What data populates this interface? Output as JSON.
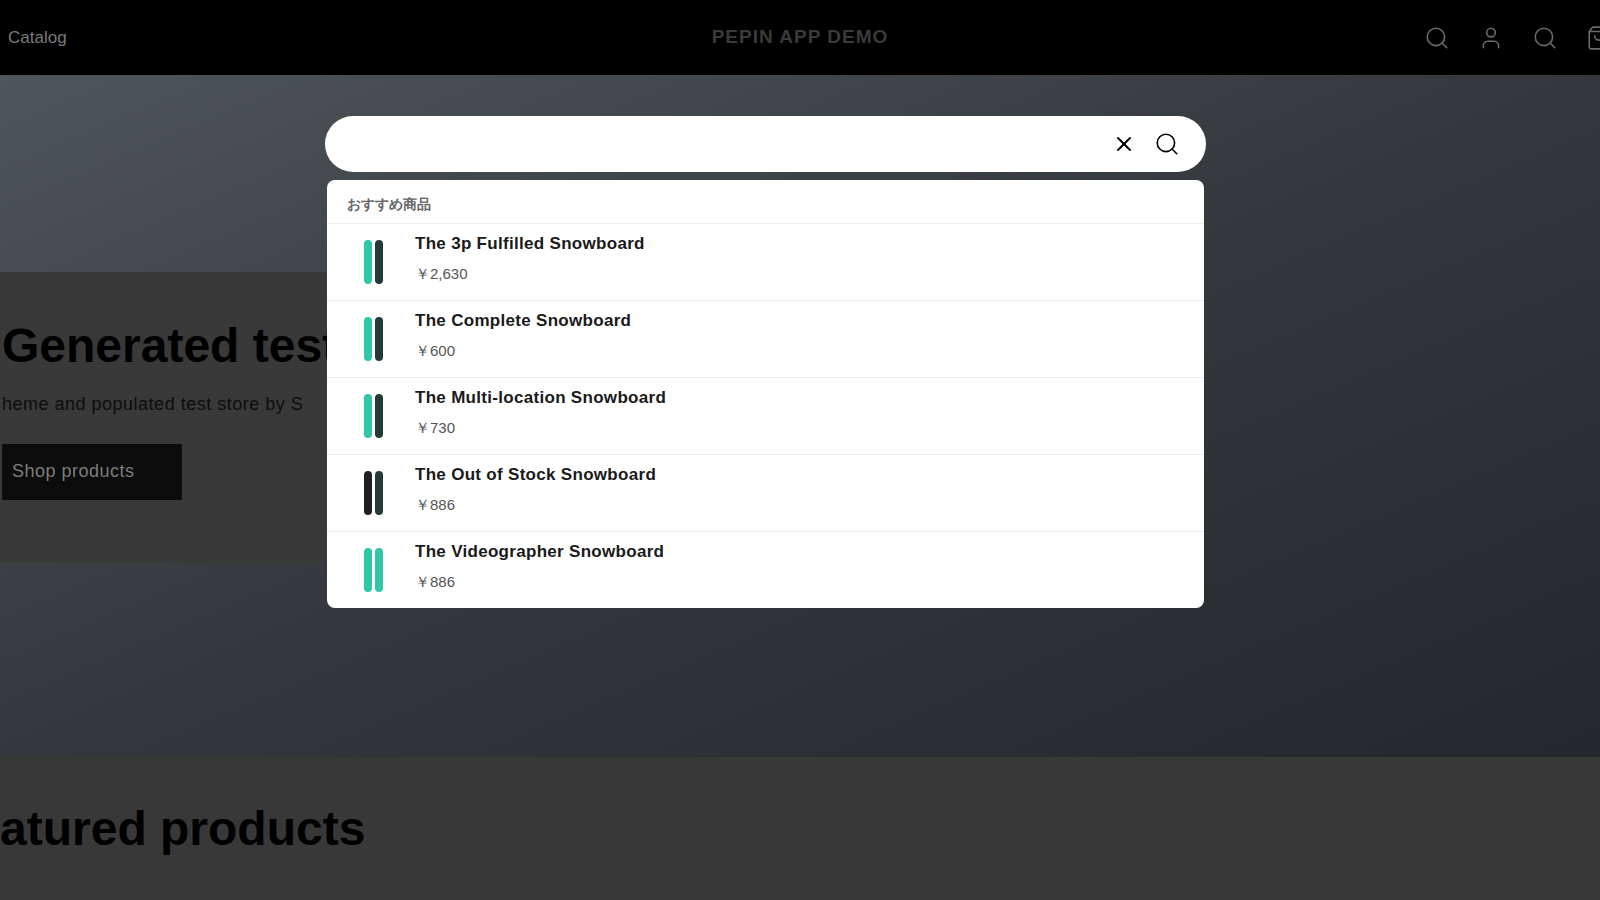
{
  "header": {
    "nav": [
      "Catalog"
    ],
    "title": "PEPIN APP DEMO"
  },
  "hero": {
    "heading": "Generated test",
    "text": "heme and populated test store by S",
    "button": "Shop products"
  },
  "featured": {
    "heading": "atured products"
  },
  "search": {
    "query": ""
  },
  "suggestions": {
    "heading": "おすすめ商品",
    "items": [
      {
        "name": "The 3p Fulfilled Snowboard",
        "price": "￥2,630"
      },
      {
        "name": "The Complete Snowboard",
        "price": "￥600"
      },
      {
        "name": "The Multi-location Snowboard",
        "price": "￥730"
      },
      {
        "name": "The Out of Stock Snowboard",
        "price": "￥886"
      },
      {
        "name": "The Videographer Snowboard",
        "price": "￥886"
      }
    ]
  }
}
